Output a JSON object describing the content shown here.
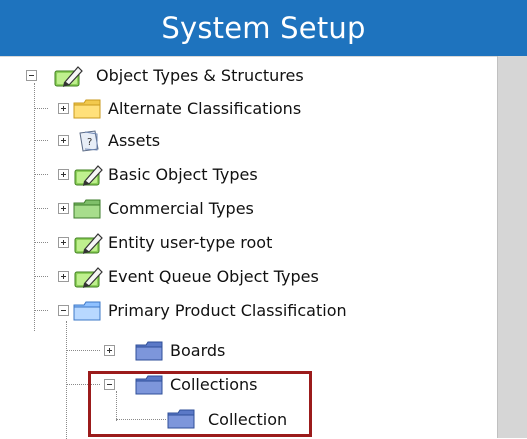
{
  "header": {
    "title": "System Setup"
  },
  "tree": {
    "root": {
      "label": "Object Types & Structures",
      "icon": "object-types-pencil-icon"
    },
    "children": [
      {
        "label": "Alternate Classifications",
        "icon": "yellow-folder-icon"
      },
      {
        "label": "Assets",
        "icon": "asset-question-icon"
      },
      {
        "label": "Basic Object Types",
        "icon": "object-types-pencil-icon"
      },
      {
        "label": "Commercial Types",
        "icon": "green-folder-icon"
      },
      {
        "label": "Entity user-type root",
        "icon": "object-types-pencil-icon"
      },
      {
        "label": "Event Queue Object Types",
        "icon": "object-types-pencil-icon"
      },
      {
        "label": "Primary Product Classification",
        "icon": "blue-folder-icon"
      }
    ],
    "ppc_children": [
      {
        "label": "Boards",
        "icon": "dark-blue-folder-icon"
      },
      {
        "label": "Collections",
        "icon": "dark-blue-folder-icon"
      }
    ],
    "collections_children": [
      {
        "label": "Collection",
        "icon": "dark-blue-folder-icon"
      }
    ]
  },
  "colors": {
    "title_bar": "#1e73be",
    "highlight_border": "#9b1b1b",
    "scrollbar": "#d6d6d6"
  }
}
